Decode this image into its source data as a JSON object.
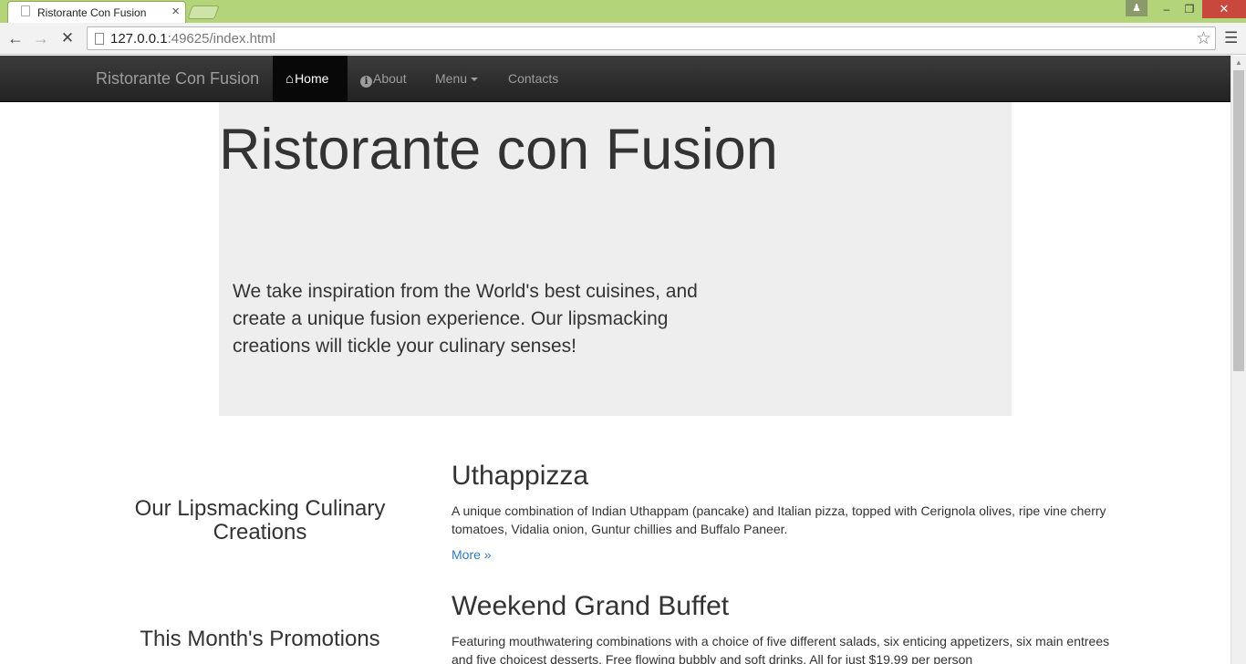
{
  "browser": {
    "tab_title": "Ristorante Con Fusion",
    "tab_close": "×",
    "url_host": "127.0.0.1",
    "url_rest": ":49625/index.html",
    "window_controls": {
      "minimize": "–",
      "restore": "❐",
      "close": "✕"
    },
    "icons": {
      "back": "arrow-left-icon",
      "forward": "arrow-right-icon",
      "stop": "stop-icon",
      "star": "star-icon",
      "menu": "hamburger-menu-icon",
      "user": "user-icon"
    }
  },
  "navbar": {
    "brand": "Ristorante Con Fusion",
    "items": [
      {
        "label": "Home",
        "icon": "home-icon",
        "active": true
      },
      {
        "label": "About",
        "icon": "info-icon",
        "active": false
      },
      {
        "label": "Menu",
        "icon": "caret-down-icon",
        "active": false
      },
      {
        "label": "Contacts",
        "icon": "",
        "active": false
      }
    ]
  },
  "jumbotron": {
    "title": "Ristorante con Fusion",
    "text": "We take inspiration from the World's best cuisines, and create a unique fusion experience. Our lipsmacking creations will tickle your culinary senses!"
  },
  "sections": [
    {
      "heading": "Our Lipsmacking Culinary Creations",
      "title": "Uthappizza",
      "description": "A unique combination of Indian Uthappam (pancake) and Italian pizza, topped with Cerignola olives, ripe vine cherry tomatoes, Vidalia onion, Guntur chillies and Buffalo Paneer.",
      "more": "More »"
    },
    {
      "heading": "This Month's Promotions",
      "title": "Weekend Grand Buffet",
      "description": "Featuring mouthwatering combinations with a choice of five different salads, six enticing appetizers, six main entrees and five choicest desserts. Free flowing bubbly and soft drinks. All for just $19.99 per person",
      "more": ""
    }
  ],
  "colors": {
    "navbar_bg": "#222222",
    "jumbotron_bg": "#eeeeee",
    "link": "#337ab7",
    "titlebar": "#b4d47a"
  }
}
